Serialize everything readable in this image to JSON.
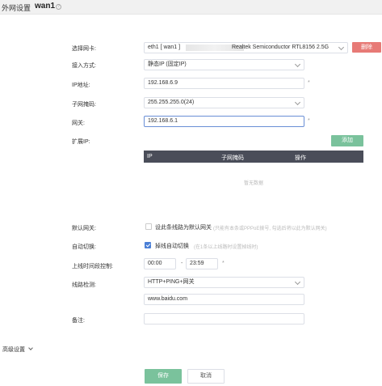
{
  "header": {
    "title": "外网设置",
    "interface": "wan1",
    "help_icon": "question-circle-icon"
  },
  "form": {
    "nic": {
      "label": "选择网卡:",
      "value_prefix": "eth1 [ wan1 ]",
      "value_suffix": "Realtek Semiconductor RTL8156 2.5G",
      "delete_label": "删除"
    },
    "access_mode": {
      "label": "接入方式:",
      "value": "静态IP (固定IP)"
    },
    "ip": {
      "label": "IP地址:",
      "value": "192.168.6.9"
    },
    "netmask": {
      "label": "子网掩码:",
      "value": "255.255.255.0(24)"
    },
    "gateway": {
      "label": "网关:",
      "value": "192.168.6.1"
    },
    "extended_ip": {
      "label": "扩展IP:",
      "add_label": "添加",
      "columns": [
        "IP",
        "子网掩码",
        "操作"
      ],
      "empty_text": "暂无数据"
    },
    "default_gateway": {
      "label": "默认网关:",
      "option": "设此条线路为默认网关",
      "hint": "(只能有本条或PPPoE拨号, 勾选后将以此为默认网关)",
      "checked": false
    },
    "auto_switch": {
      "label": "自动切换:",
      "option": "掉线自动切换",
      "hint": "(在1条以上线路时设置掉线时)",
      "checked": true
    },
    "online_time": {
      "label": "上线时间段控制:",
      "start": "00:00",
      "separator": "-",
      "end": "23:59"
    },
    "line_check": {
      "label": "线路检测:",
      "method": "HTTP+PING+网关",
      "target": "www.baidu.com"
    },
    "remark": {
      "label": "备注:",
      "value": ""
    }
  },
  "advanced": {
    "label": "高级设置"
  },
  "actions": {
    "save_label": "保存",
    "cancel_label": "取消"
  },
  "colors": {
    "primary_green": "#7ac29c",
    "danger_red": "#e77a76",
    "table_header": "#4a4d59",
    "checkbox_blue": "#4a7fd6"
  }
}
